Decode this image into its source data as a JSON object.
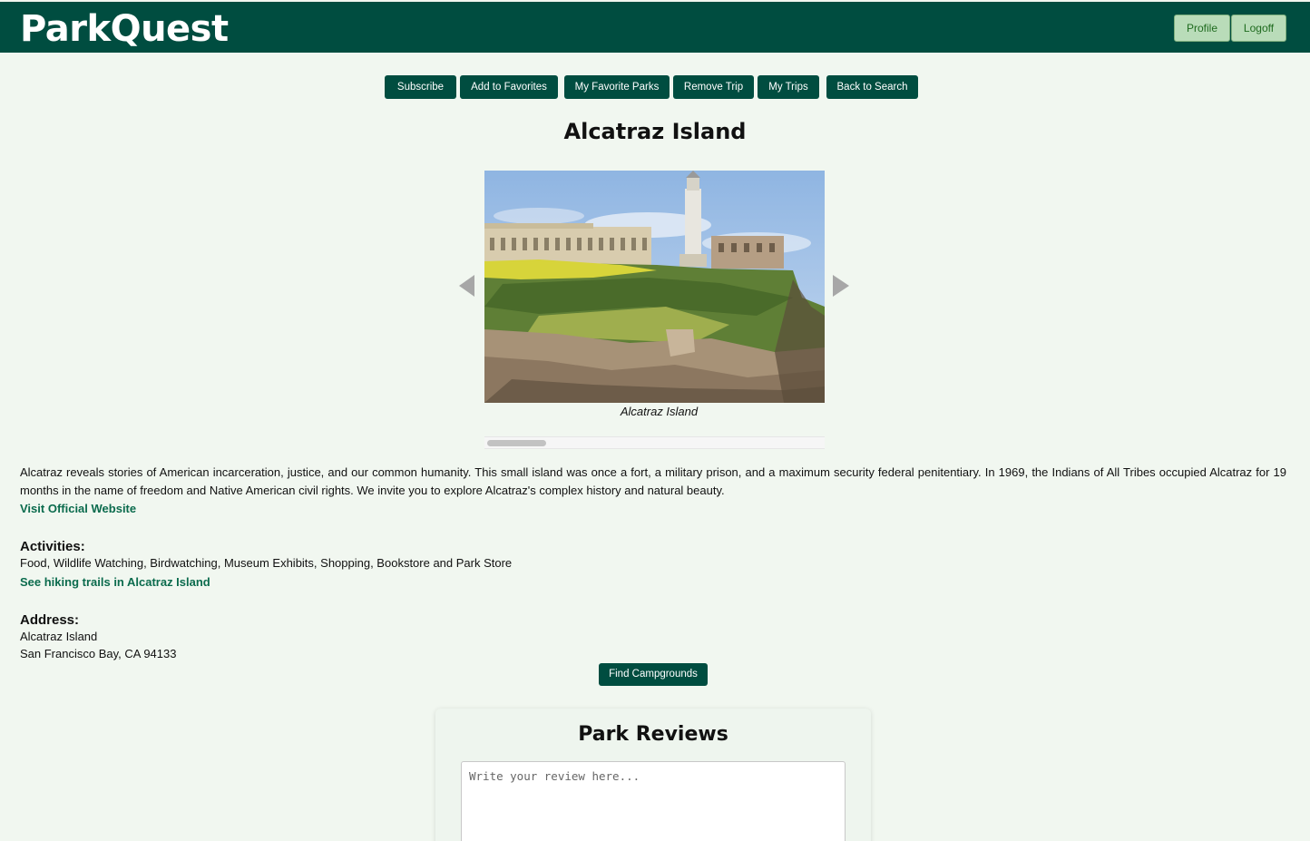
{
  "app": {
    "brand": "ParkQuest"
  },
  "header": {
    "profile_label": "Profile",
    "logoff_label": "Logoff"
  },
  "nav": {
    "subscribe": "Subscribe",
    "add_favorites": "Add to Favorites",
    "my_favorite_parks": "My Favorite Parks",
    "remove_trip": "Remove Trip",
    "my_trips": "My Trips",
    "back_to_search": "Back to Search"
  },
  "park": {
    "name": "Alcatraz Island",
    "image_caption": "Alcatraz Island",
    "description": "Alcatraz reveals stories of American incarceration, justice, and our common humanity. This small island was once a fort, a military prison, and a maximum security federal penitentiary. In 1969, the Indians of All Tribes occupied Alcatraz for 19 months in the name of freedom and Native American civil rights. We invite you to explore Alcatraz's complex history and natural beauty.",
    "website_link": "Visit Official Website",
    "activities_heading": "Activities:",
    "activities": "Food, Wildlife Watching, Birdwatching, Museum Exhibits, Shopping, Bookstore and Park Store",
    "trails_link": "See hiking trails in Alcatraz Island",
    "address_heading": "Address:",
    "address_line1": "Alcatraz Island",
    "address_line2": "San Francisco Bay, CA 94133"
  },
  "actions": {
    "find_campgrounds": "Find Campgrounds"
  },
  "reviews": {
    "title": "Park Reviews",
    "placeholder": "Write your review here..."
  },
  "colors": {
    "header_bg": "#004d40",
    "page_bg": "#f1f7f0",
    "link": "#0b6b4d"
  }
}
